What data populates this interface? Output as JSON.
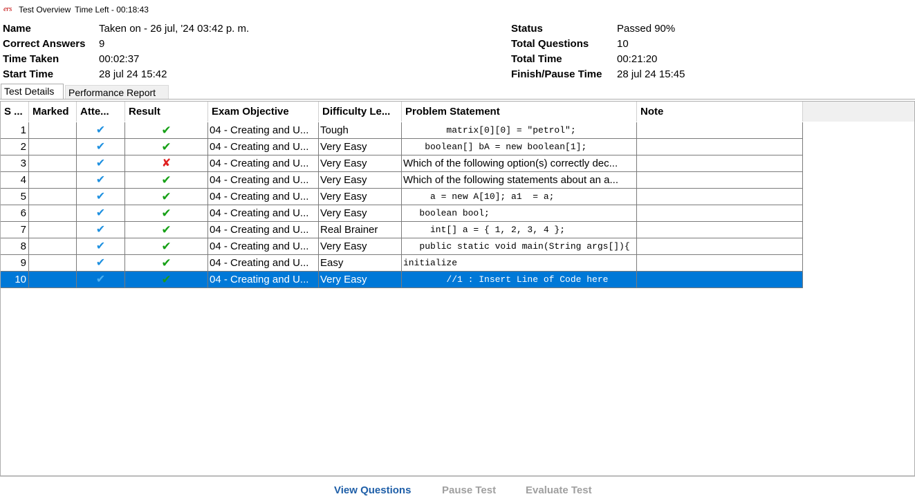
{
  "titlebar": {
    "logo": "ers",
    "title": "Test Overview",
    "time_left": "Time Left - 00:18:43"
  },
  "summary": {
    "left": [
      {
        "label": "Name",
        "value": "Taken on - 26 jul, '24 03:42 p. m."
      },
      {
        "label": "Correct Answers",
        "value": "9"
      },
      {
        "label": "Time Taken",
        "value": "00:02:37"
      },
      {
        "label": "Start Time",
        "value": "28 jul 24 15:42"
      }
    ],
    "right": [
      {
        "label": "Status",
        "value": "Passed 90%"
      },
      {
        "label": "Total Questions",
        "value": "10"
      },
      {
        "label": "Total Time",
        "value": "00:21:20"
      },
      {
        "label": "Finish/Pause Time",
        "value": "28 jul 24 15:45"
      }
    ]
  },
  "tabs": [
    "Test Details",
    "Performance Report"
  ],
  "table": {
    "columns": [
      "S ...",
      "Marked",
      "Atte...",
      "Result",
      "Exam Objective",
      "Difficulty Le...",
      "Problem Statement",
      "Note"
    ],
    "rows": [
      {
        "num": "1",
        "marked": "",
        "attempted": "✔",
        "result": "✔",
        "result_ok": true,
        "objective": "04 - Creating and U...",
        "difficulty": "Tough",
        "problem": "        matrix[0][0] = \"petrol\";"
      },
      {
        "num": "2",
        "marked": "",
        "attempted": "✔",
        "result": "✔",
        "result_ok": true,
        "objective": "04 - Creating and U...",
        "difficulty": "Very Easy",
        "problem": "    boolean[] bA = new boolean[1];"
      },
      {
        "num": "3",
        "marked": "",
        "attempted": "✔",
        "result": "✘",
        "result_ok": false,
        "objective": "04 - Creating and U...",
        "difficulty": "Very Easy",
        "problem": "Which of the following option(s) correctly dec..."
      },
      {
        "num": "4",
        "marked": "",
        "attempted": "✔",
        "result": "✔",
        "result_ok": true,
        "objective": "04 - Creating and U...",
        "difficulty": "Very Easy",
        "problem": "Which of the following statements about an a..."
      },
      {
        "num": "5",
        "marked": "",
        "attempted": "✔",
        "result": "✔",
        "result_ok": true,
        "objective": "04 - Creating and U...",
        "difficulty": "Very Easy",
        "problem": "     a = new A[10]; a1  = a;"
      },
      {
        "num": "6",
        "marked": "",
        "attempted": "✔",
        "result": "✔",
        "result_ok": true,
        "objective": "04 - Creating and U...",
        "difficulty": "Very Easy",
        "problem": "   boolean bool;"
      },
      {
        "num": "7",
        "marked": "",
        "attempted": "✔",
        "result": "✔",
        "result_ok": true,
        "objective": "04 - Creating and U...",
        "difficulty": "Real Brainer",
        "problem": "     int[] a = { 1, 2, 3, 4 };"
      },
      {
        "num": "8",
        "marked": "",
        "attempted": "✔",
        "result": "✔",
        "result_ok": true,
        "objective": "04 - Creating and U...",
        "difficulty": "Very Easy",
        "problem": "   public static void main(String args[]){"
      },
      {
        "num": "9",
        "marked": "",
        "attempted": "✔",
        "result": "✔",
        "result_ok": true,
        "objective": "04 - Creating and U...",
        "difficulty": "Easy",
        "problem": "initialize"
      },
      {
        "num": "10",
        "marked": "",
        "attempted": "✔",
        "result": "✔",
        "result_ok": true,
        "objective": "04 - Creating and U...",
        "difficulty": "Very Easy",
        "problem": "        //1 : Insert Line of Code here"
      }
    ],
    "selected_row": "10"
  },
  "buttons": {
    "view_questions": "View Questions",
    "pause_test": "Pause Test",
    "evaluate_test": "Evaluate Test"
  },
  "colors": {
    "selection": "#0078d7",
    "check_blue": "#1e90e0",
    "check_green": "#16a016",
    "cross_red": "#e02020",
    "link_blue": "#1f5fa8"
  }
}
